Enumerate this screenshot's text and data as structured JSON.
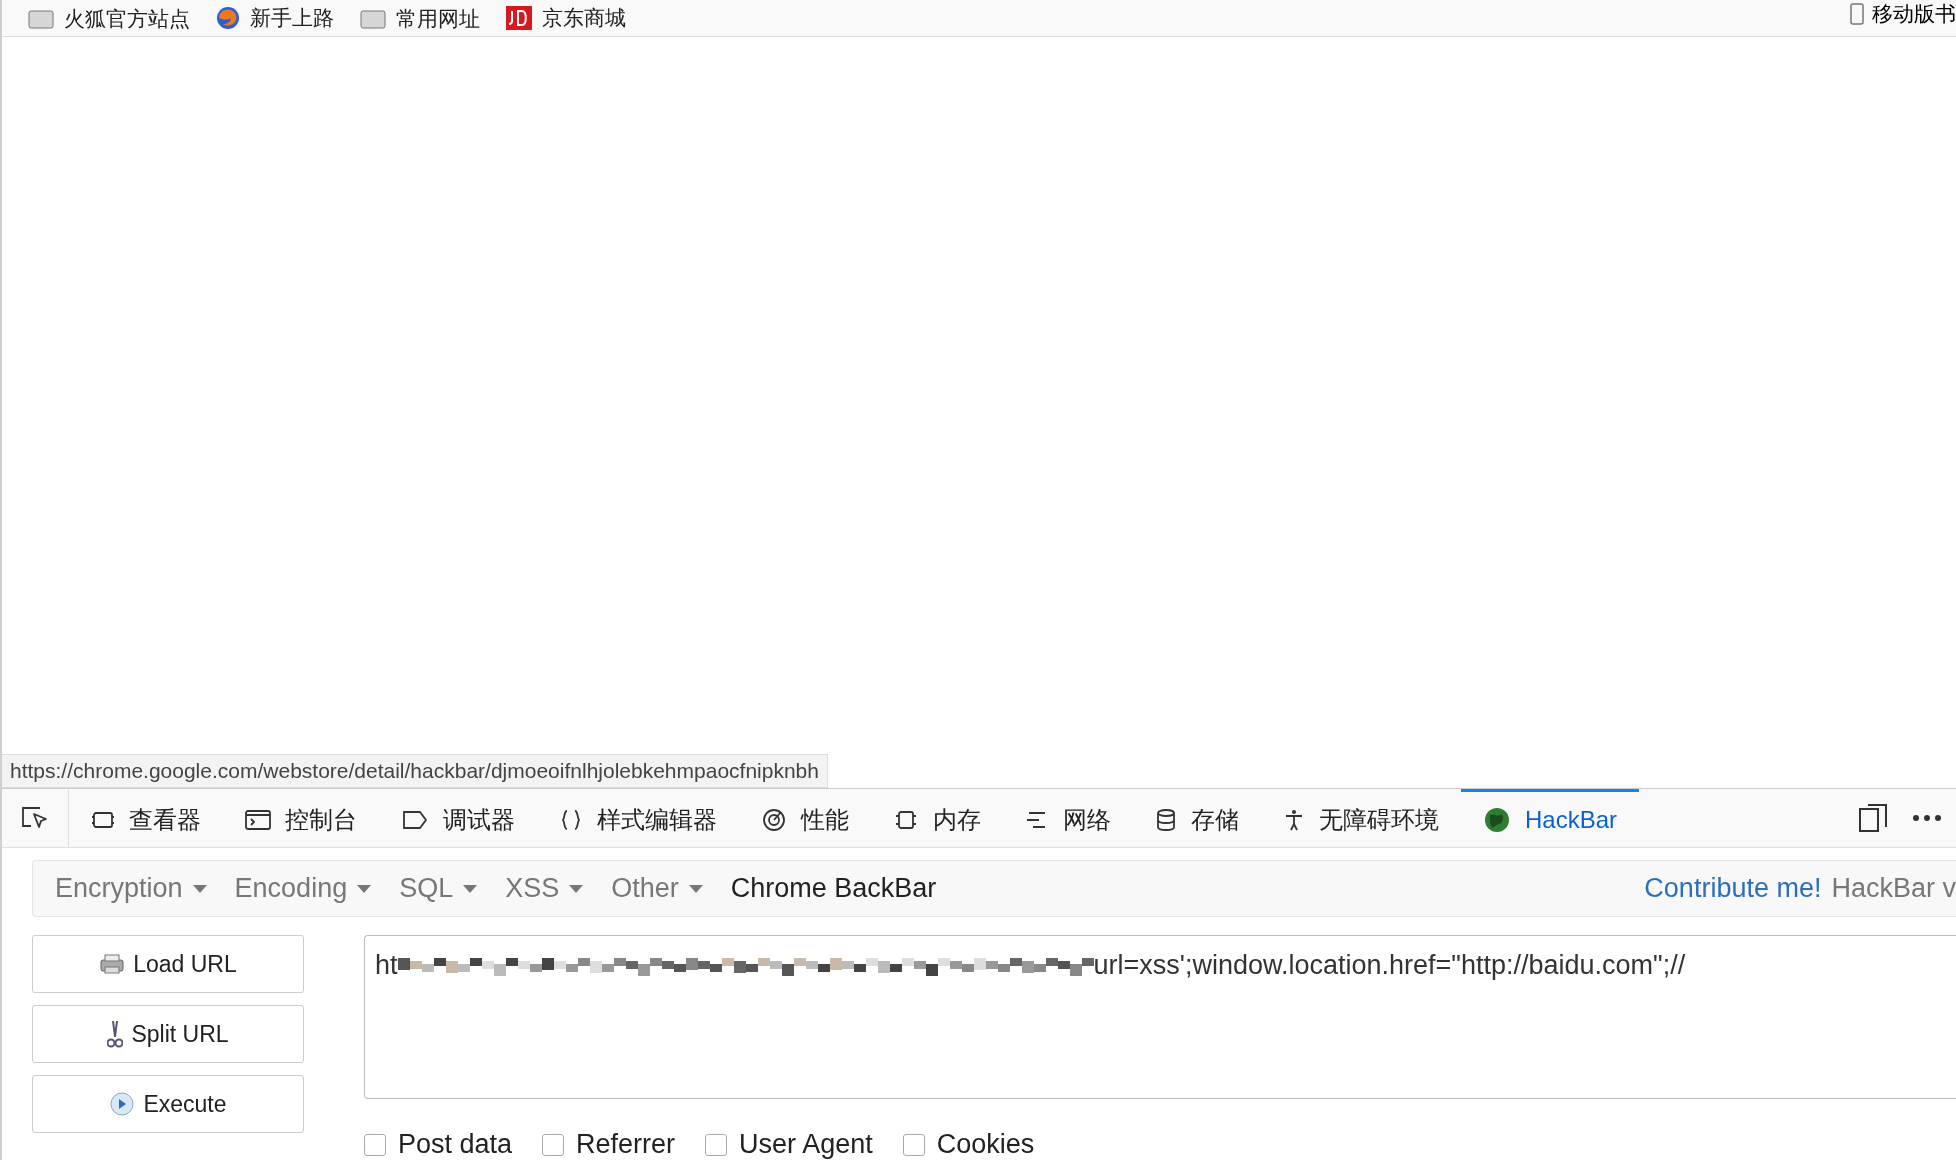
{
  "bookmarks": [
    {
      "label": "火狐官方站点",
      "kind": "folder"
    },
    {
      "label": "新手上路",
      "kind": "globe"
    },
    {
      "label": "常用网址",
      "kind": "folder"
    },
    {
      "label": "京东商城",
      "kind": "jd"
    }
  ],
  "bookmarks_right": {
    "label": "移动版书"
  },
  "status_url": "https://chrome.google.com/webstore/detail/hackbar/djmoeoifnlhjolebkehmpaocfnipknbh",
  "devtools_tabs": [
    {
      "label": "查看器",
      "kind": "inspector",
      "selected": false
    },
    {
      "label": "控制台",
      "kind": "console",
      "selected": false
    },
    {
      "label": "调试器",
      "kind": "debugger",
      "selected": false
    },
    {
      "label": "样式编辑器",
      "kind": "style",
      "selected": false
    },
    {
      "label": "性能",
      "kind": "performance",
      "selected": false
    },
    {
      "label": "内存",
      "kind": "memory",
      "selected": false
    },
    {
      "label": "网络",
      "kind": "network",
      "selected": false
    },
    {
      "label": "存储",
      "kind": "storage",
      "selected": false
    },
    {
      "label": "无障碍环境",
      "kind": "accessibility",
      "selected": false
    },
    {
      "label": "HackBar",
      "kind": "hackbar",
      "selected": true
    }
  ],
  "hackbar_menu": [
    {
      "label": "Encryption",
      "dropdown": true
    },
    {
      "label": "Encoding",
      "dropdown": true
    },
    {
      "label": "SQL",
      "dropdown": true
    },
    {
      "label": "XSS",
      "dropdown": true
    },
    {
      "label": "Other",
      "dropdown": true
    },
    {
      "label": "Chrome BackBar",
      "dropdown": false
    }
  ],
  "contribute_link": "Contribute me!",
  "hackbar_version": "HackBar v",
  "actions": [
    {
      "label": "Load URL",
      "kind": "load"
    },
    {
      "label": "Split URL",
      "kind": "split"
    },
    {
      "label": "Execute",
      "kind": "execute"
    }
  ],
  "url_field": {
    "prefix": "ht",
    "suffix": "url=xss';window.location.href=\"http://baidu.com\";//"
  },
  "options": [
    {
      "label": "Post data",
      "checked": false
    },
    {
      "label": "Referrer",
      "checked": false
    },
    {
      "label": "User Agent",
      "checked": false
    },
    {
      "label": "Cookies",
      "checked": false
    }
  ]
}
